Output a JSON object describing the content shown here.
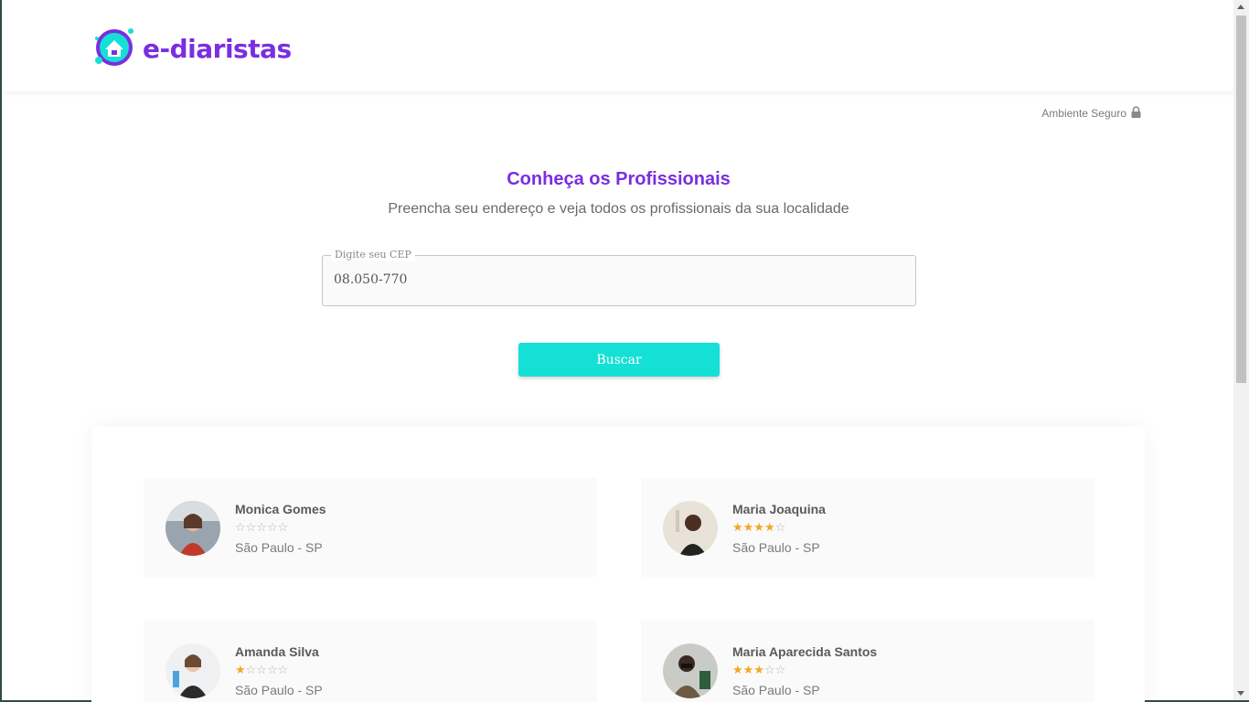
{
  "brand": {
    "name": "e-diaristas",
    "logo_icon": "house-cleaning-logo-icon",
    "color": "#7a2ee0",
    "accent": "#14e0d6"
  },
  "secure": {
    "label": "Ambiente Seguro",
    "icon": "lock-icon"
  },
  "hero": {
    "title": "Conheça os Profissionais",
    "subtitle": "Preencha seu endereço e veja todos os profissionais da sua localidade"
  },
  "search": {
    "label": "Digite seu CEP",
    "value": "08.050-770",
    "button": "Buscar"
  },
  "professionals": [
    {
      "name": "Monica Gomes",
      "rating": 0,
      "max_rating": 5,
      "stars": "☆☆☆☆☆",
      "city": "São Paulo - SP"
    },
    {
      "name": "Maria Joaquina",
      "rating": 4,
      "max_rating": 5,
      "stars": "★★★★☆",
      "city": "São Paulo - SP"
    },
    {
      "name": "Amanda Silva",
      "rating": 1,
      "max_rating": 5,
      "stars": "★☆☆☆☆",
      "city": "São Paulo - SP"
    },
    {
      "name": "Maria Aparecida Santos",
      "rating": 3,
      "max_rating": 5,
      "stars": "★★★☆☆",
      "city": "São Paulo - SP"
    }
  ]
}
